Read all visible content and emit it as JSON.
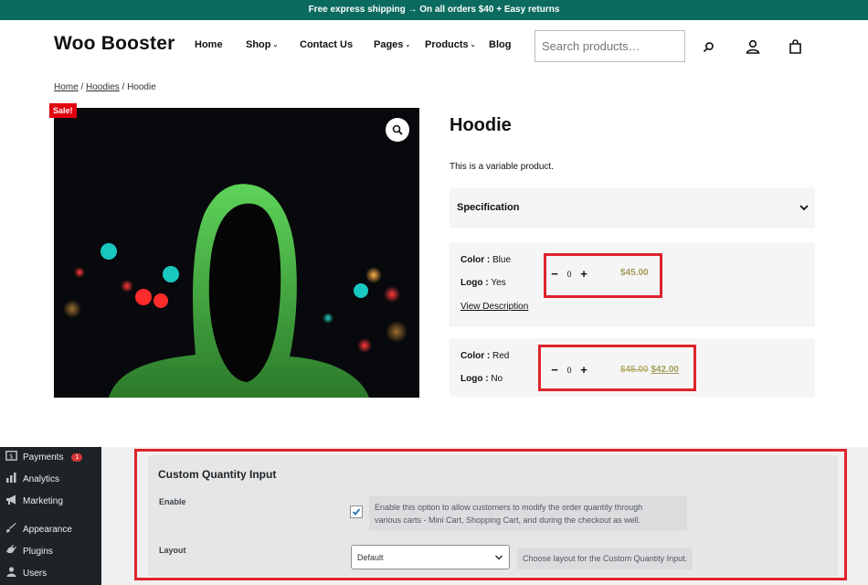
{
  "topbar": {
    "text": "Free express shipping → On all orders $40 + Easy returns"
  },
  "site": {
    "logo": "Woo Booster"
  },
  "nav": {
    "home": "Home",
    "shop": "Shop",
    "contact": "Contact Us",
    "pages": "Pages",
    "products": "Products",
    "blog": "Blog"
  },
  "search": {
    "placeholder": "Search products…"
  },
  "breadcrumb": {
    "home": "Home",
    "sep1": " / ",
    "hoodies": "Hoodies",
    "sep2": " / ",
    "current": "Hoodie"
  },
  "product": {
    "sale_badge": "Sale!",
    "title": "Hoodie",
    "description": "This is a variable product.",
    "spec_label": "Specification"
  },
  "variants": [
    {
      "color_label": "Color : ",
      "color": "Blue",
      "logo_label": "Logo : ",
      "logo": "Yes",
      "qty": "0",
      "price": "$45.00",
      "link": "View Description"
    },
    {
      "color_label": "Color : ",
      "color": "Red",
      "logo_label": "Logo : ",
      "logo": "No",
      "qty": "0",
      "old_price": "$45.00",
      "new_price": "$42.00"
    }
  ],
  "qty_minus": "−",
  "qty_plus": "+",
  "admin": {
    "menu": [
      {
        "label": "Payments",
        "badge": "1",
        "icon": "payments-icon"
      },
      {
        "label": "Analytics",
        "icon": "analytics-icon"
      },
      {
        "label": "Marketing",
        "icon": "megaphone-icon"
      },
      {
        "label": "Appearance",
        "icon": "paintbrush-icon"
      },
      {
        "label": "Plugins",
        "icon": "plugin-icon"
      },
      {
        "label": "Users",
        "icon": "users-icon"
      }
    ]
  },
  "settings": {
    "title": "Custom Quantity Input",
    "enable_label": "Enable",
    "enable_tip_line1": "Enable this option to allow customers to modify the order quantity through",
    "enable_tip_line2": "various carts - Mini Cart, Shopping Cart, and during the checkout as well.",
    "layout_label": "Layout",
    "layout_value": "Default",
    "layout_tip": "Choose layout for the Custom Quantity Input."
  },
  "colors": {
    "brand_bar": "#0b6b5f",
    "sale": "#e3000f",
    "highlight": "#e0232b",
    "price": "#a29c5a"
  }
}
